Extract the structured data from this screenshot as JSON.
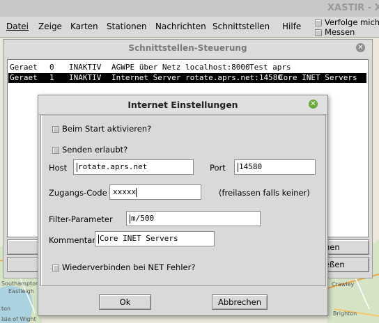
{
  "window": {
    "title": "XASTIR - X A"
  },
  "menubar": {
    "items": [
      {
        "label": "Datei"
      },
      {
        "label": "Zeige"
      },
      {
        "label": "Karten"
      },
      {
        "label": "Stationen"
      },
      {
        "label": "Nachrichten"
      },
      {
        "label": "Schnittstellen"
      },
      {
        "label": "Hilfe"
      }
    ],
    "toggles": [
      {
        "label": "Verfolge mich",
        "checked": false
      },
      {
        "label": "Messen",
        "checked": false
      }
    ]
  },
  "map": {
    "labels": [
      "Southampton",
      "Eastleigh",
      "ton",
      "Isle of Wight",
      "Crawley",
      "Brighton"
    ]
  },
  "interface_dialog": {
    "title": "Schnittstellen-Steuerung",
    "rows": [
      {
        "device": "Geraet",
        "num": "0",
        "status": "INAKTIV",
        "desc": "AGWPE über Netz localhost:8000",
        "comment": "Test aprs",
        "selected": false
      },
      {
        "device": "Geraet",
        "num": "1",
        "status": "INAKTIV",
        "desc": "Internet Server rotate.aprs.net:14580",
        "comment": "Core INET Servers",
        "selected": true
      }
    ],
    "buttons": {
      "right_top": "hen",
      "right_bottom": "eßen"
    }
  },
  "internet_dialog": {
    "title": "Internet Einstellungen",
    "activate_on_start": {
      "label": "Beim Start aktivieren?",
      "checked": false
    },
    "transmit_allowed": {
      "label": "Senden erlaubt?",
      "checked": false
    },
    "host": {
      "label": "Host",
      "value": "rotate.aprs.net"
    },
    "port": {
      "label": "Port",
      "value": "14580"
    },
    "passcode": {
      "label": "Zugangs-Code",
      "value": "xxxxx",
      "hint": "(freilassen falls keiner)"
    },
    "filter": {
      "label": "Filter-Parameter",
      "value": "m/500"
    },
    "comment": {
      "label": "Kommentar:",
      "value": "Core INET Servers"
    },
    "reconnect": {
      "label": "Wiederverbinden bei NET Fehler?",
      "checked": false
    },
    "ok_label": "Ok",
    "cancel_label": "Abbrechen"
  },
  "colors": {
    "accent_green": "#6aaa3c",
    "close_grey": "#8e8e8e",
    "selected_row": "#000000"
  }
}
